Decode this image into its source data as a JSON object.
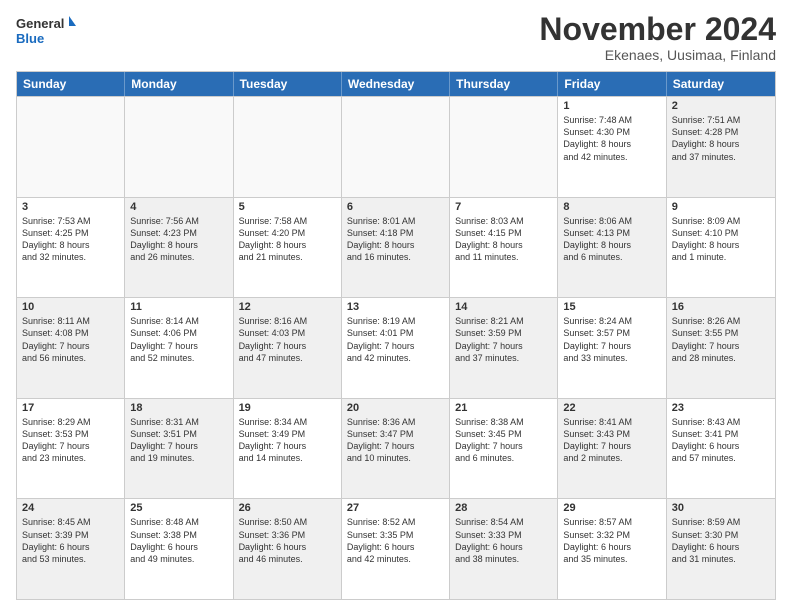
{
  "header": {
    "logo_line1": "General",
    "logo_line2": "Blue",
    "month": "November 2024",
    "location": "Ekenaes, Uusimaa, Finland"
  },
  "days_of_week": [
    "Sunday",
    "Monday",
    "Tuesday",
    "Wednesday",
    "Thursday",
    "Friday",
    "Saturday"
  ],
  "weeks": [
    [
      {
        "day": "",
        "info": "",
        "empty": true
      },
      {
        "day": "",
        "info": "",
        "empty": true
      },
      {
        "day": "",
        "info": "",
        "empty": true
      },
      {
        "day": "",
        "info": "",
        "empty": true
      },
      {
        "day": "",
        "info": "",
        "empty": true
      },
      {
        "day": "1",
        "info": "Sunrise: 7:48 AM\nSunset: 4:30 PM\nDaylight: 8 hours\nand 42 minutes.",
        "empty": false
      },
      {
        "day": "2",
        "info": "Sunrise: 7:51 AM\nSunset: 4:28 PM\nDaylight: 8 hours\nand 37 minutes.",
        "empty": false,
        "shaded": true
      }
    ],
    [
      {
        "day": "3",
        "info": "Sunrise: 7:53 AM\nSunset: 4:25 PM\nDaylight: 8 hours\nand 32 minutes.",
        "empty": false
      },
      {
        "day": "4",
        "info": "Sunrise: 7:56 AM\nSunset: 4:23 PM\nDaylight: 8 hours\nand 26 minutes.",
        "empty": false,
        "shaded": true
      },
      {
        "day": "5",
        "info": "Sunrise: 7:58 AM\nSunset: 4:20 PM\nDaylight: 8 hours\nand 21 minutes.",
        "empty": false
      },
      {
        "day": "6",
        "info": "Sunrise: 8:01 AM\nSunset: 4:18 PM\nDaylight: 8 hours\nand 16 minutes.",
        "empty": false,
        "shaded": true
      },
      {
        "day": "7",
        "info": "Sunrise: 8:03 AM\nSunset: 4:15 PM\nDaylight: 8 hours\nand 11 minutes.",
        "empty": false
      },
      {
        "day": "8",
        "info": "Sunrise: 8:06 AM\nSunset: 4:13 PM\nDaylight: 8 hours\nand 6 minutes.",
        "empty": false,
        "shaded": true
      },
      {
        "day": "9",
        "info": "Sunrise: 8:09 AM\nSunset: 4:10 PM\nDaylight: 8 hours\nand 1 minute.",
        "empty": false
      }
    ],
    [
      {
        "day": "10",
        "info": "Sunrise: 8:11 AM\nSunset: 4:08 PM\nDaylight: 7 hours\nand 56 minutes.",
        "empty": false,
        "shaded": true
      },
      {
        "day": "11",
        "info": "Sunrise: 8:14 AM\nSunset: 4:06 PM\nDaylight: 7 hours\nand 52 minutes.",
        "empty": false
      },
      {
        "day": "12",
        "info": "Sunrise: 8:16 AM\nSunset: 4:03 PM\nDaylight: 7 hours\nand 47 minutes.",
        "empty": false,
        "shaded": true
      },
      {
        "day": "13",
        "info": "Sunrise: 8:19 AM\nSunset: 4:01 PM\nDaylight: 7 hours\nand 42 minutes.",
        "empty": false
      },
      {
        "day": "14",
        "info": "Sunrise: 8:21 AM\nSunset: 3:59 PM\nDaylight: 7 hours\nand 37 minutes.",
        "empty": false,
        "shaded": true
      },
      {
        "day": "15",
        "info": "Sunrise: 8:24 AM\nSunset: 3:57 PM\nDaylight: 7 hours\nand 33 minutes.",
        "empty": false
      },
      {
        "day": "16",
        "info": "Sunrise: 8:26 AM\nSunset: 3:55 PM\nDaylight: 7 hours\nand 28 minutes.",
        "empty": false,
        "shaded": true
      }
    ],
    [
      {
        "day": "17",
        "info": "Sunrise: 8:29 AM\nSunset: 3:53 PM\nDaylight: 7 hours\nand 23 minutes.",
        "empty": false
      },
      {
        "day": "18",
        "info": "Sunrise: 8:31 AM\nSunset: 3:51 PM\nDaylight: 7 hours\nand 19 minutes.",
        "empty": false,
        "shaded": true
      },
      {
        "day": "19",
        "info": "Sunrise: 8:34 AM\nSunset: 3:49 PM\nDaylight: 7 hours\nand 14 minutes.",
        "empty": false
      },
      {
        "day": "20",
        "info": "Sunrise: 8:36 AM\nSunset: 3:47 PM\nDaylight: 7 hours\nand 10 minutes.",
        "empty": false,
        "shaded": true
      },
      {
        "day": "21",
        "info": "Sunrise: 8:38 AM\nSunset: 3:45 PM\nDaylight: 7 hours\nand 6 minutes.",
        "empty": false
      },
      {
        "day": "22",
        "info": "Sunrise: 8:41 AM\nSunset: 3:43 PM\nDaylight: 7 hours\nand 2 minutes.",
        "empty": false,
        "shaded": true
      },
      {
        "day": "23",
        "info": "Sunrise: 8:43 AM\nSunset: 3:41 PM\nDaylight: 6 hours\nand 57 minutes.",
        "empty": false
      }
    ],
    [
      {
        "day": "24",
        "info": "Sunrise: 8:45 AM\nSunset: 3:39 PM\nDaylight: 6 hours\nand 53 minutes.",
        "empty": false,
        "shaded": true
      },
      {
        "day": "25",
        "info": "Sunrise: 8:48 AM\nSunset: 3:38 PM\nDaylight: 6 hours\nand 49 minutes.",
        "empty": false
      },
      {
        "day": "26",
        "info": "Sunrise: 8:50 AM\nSunset: 3:36 PM\nDaylight: 6 hours\nand 46 minutes.",
        "empty": false,
        "shaded": true
      },
      {
        "day": "27",
        "info": "Sunrise: 8:52 AM\nSunset: 3:35 PM\nDaylight: 6 hours\nand 42 minutes.",
        "empty": false
      },
      {
        "day": "28",
        "info": "Sunrise: 8:54 AM\nSunset: 3:33 PM\nDaylight: 6 hours\nand 38 minutes.",
        "empty": false,
        "shaded": true
      },
      {
        "day": "29",
        "info": "Sunrise: 8:57 AM\nSunset: 3:32 PM\nDaylight: 6 hours\nand 35 minutes.",
        "empty": false
      },
      {
        "day": "30",
        "info": "Sunrise: 8:59 AM\nSunset: 3:30 PM\nDaylight: 6 hours\nand 31 minutes.",
        "empty": false,
        "shaded": true
      }
    ]
  ]
}
